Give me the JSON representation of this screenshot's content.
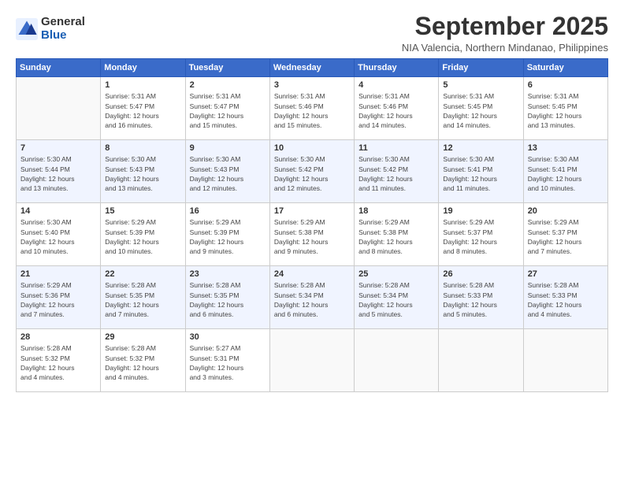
{
  "logo": {
    "general": "General",
    "blue": "Blue"
  },
  "title": "September 2025",
  "subtitle": "NIA Valencia, Northern Mindanao, Philippines",
  "days_header": [
    "Sunday",
    "Monday",
    "Tuesday",
    "Wednesday",
    "Thursday",
    "Friday",
    "Saturday"
  ],
  "weeks": [
    [
      {
        "day": "",
        "info": ""
      },
      {
        "day": "1",
        "info": "Sunrise: 5:31 AM\nSunset: 5:47 PM\nDaylight: 12 hours\nand 16 minutes."
      },
      {
        "day": "2",
        "info": "Sunrise: 5:31 AM\nSunset: 5:47 PM\nDaylight: 12 hours\nand 15 minutes."
      },
      {
        "day": "3",
        "info": "Sunrise: 5:31 AM\nSunset: 5:46 PM\nDaylight: 12 hours\nand 15 minutes."
      },
      {
        "day": "4",
        "info": "Sunrise: 5:31 AM\nSunset: 5:46 PM\nDaylight: 12 hours\nand 14 minutes."
      },
      {
        "day": "5",
        "info": "Sunrise: 5:31 AM\nSunset: 5:45 PM\nDaylight: 12 hours\nand 14 minutes."
      },
      {
        "day": "6",
        "info": "Sunrise: 5:31 AM\nSunset: 5:45 PM\nDaylight: 12 hours\nand 13 minutes."
      }
    ],
    [
      {
        "day": "7",
        "info": "Sunrise: 5:30 AM\nSunset: 5:44 PM\nDaylight: 12 hours\nand 13 minutes."
      },
      {
        "day": "8",
        "info": "Sunrise: 5:30 AM\nSunset: 5:43 PM\nDaylight: 12 hours\nand 13 minutes."
      },
      {
        "day": "9",
        "info": "Sunrise: 5:30 AM\nSunset: 5:43 PM\nDaylight: 12 hours\nand 12 minutes."
      },
      {
        "day": "10",
        "info": "Sunrise: 5:30 AM\nSunset: 5:42 PM\nDaylight: 12 hours\nand 12 minutes."
      },
      {
        "day": "11",
        "info": "Sunrise: 5:30 AM\nSunset: 5:42 PM\nDaylight: 12 hours\nand 11 minutes."
      },
      {
        "day": "12",
        "info": "Sunrise: 5:30 AM\nSunset: 5:41 PM\nDaylight: 12 hours\nand 11 minutes."
      },
      {
        "day": "13",
        "info": "Sunrise: 5:30 AM\nSunset: 5:41 PM\nDaylight: 12 hours\nand 10 minutes."
      }
    ],
    [
      {
        "day": "14",
        "info": "Sunrise: 5:30 AM\nSunset: 5:40 PM\nDaylight: 12 hours\nand 10 minutes."
      },
      {
        "day": "15",
        "info": "Sunrise: 5:29 AM\nSunset: 5:39 PM\nDaylight: 12 hours\nand 10 minutes."
      },
      {
        "day": "16",
        "info": "Sunrise: 5:29 AM\nSunset: 5:39 PM\nDaylight: 12 hours\nand 9 minutes."
      },
      {
        "day": "17",
        "info": "Sunrise: 5:29 AM\nSunset: 5:38 PM\nDaylight: 12 hours\nand 9 minutes."
      },
      {
        "day": "18",
        "info": "Sunrise: 5:29 AM\nSunset: 5:38 PM\nDaylight: 12 hours\nand 8 minutes."
      },
      {
        "day": "19",
        "info": "Sunrise: 5:29 AM\nSunset: 5:37 PM\nDaylight: 12 hours\nand 8 minutes."
      },
      {
        "day": "20",
        "info": "Sunrise: 5:29 AM\nSunset: 5:37 PM\nDaylight: 12 hours\nand 7 minutes."
      }
    ],
    [
      {
        "day": "21",
        "info": "Sunrise: 5:29 AM\nSunset: 5:36 PM\nDaylight: 12 hours\nand 7 minutes."
      },
      {
        "day": "22",
        "info": "Sunrise: 5:28 AM\nSunset: 5:35 PM\nDaylight: 12 hours\nand 7 minutes."
      },
      {
        "day": "23",
        "info": "Sunrise: 5:28 AM\nSunset: 5:35 PM\nDaylight: 12 hours\nand 6 minutes."
      },
      {
        "day": "24",
        "info": "Sunrise: 5:28 AM\nSunset: 5:34 PM\nDaylight: 12 hours\nand 6 minutes."
      },
      {
        "day": "25",
        "info": "Sunrise: 5:28 AM\nSunset: 5:34 PM\nDaylight: 12 hours\nand 5 minutes."
      },
      {
        "day": "26",
        "info": "Sunrise: 5:28 AM\nSunset: 5:33 PM\nDaylight: 12 hours\nand 5 minutes."
      },
      {
        "day": "27",
        "info": "Sunrise: 5:28 AM\nSunset: 5:33 PM\nDaylight: 12 hours\nand 4 minutes."
      }
    ],
    [
      {
        "day": "28",
        "info": "Sunrise: 5:28 AM\nSunset: 5:32 PM\nDaylight: 12 hours\nand 4 minutes."
      },
      {
        "day": "29",
        "info": "Sunrise: 5:28 AM\nSunset: 5:32 PM\nDaylight: 12 hours\nand 4 minutes."
      },
      {
        "day": "30",
        "info": "Sunrise: 5:27 AM\nSunset: 5:31 PM\nDaylight: 12 hours\nand 3 minutes."
      },
      {
        "day": "",
        "info": ""
      },
      {
        "day": "",
        "info": ""
      },
      {
        "day": "",
        "info": ""
      },
      {
        "day": "",
        "info": ""
      }
    ]
  ]
}
